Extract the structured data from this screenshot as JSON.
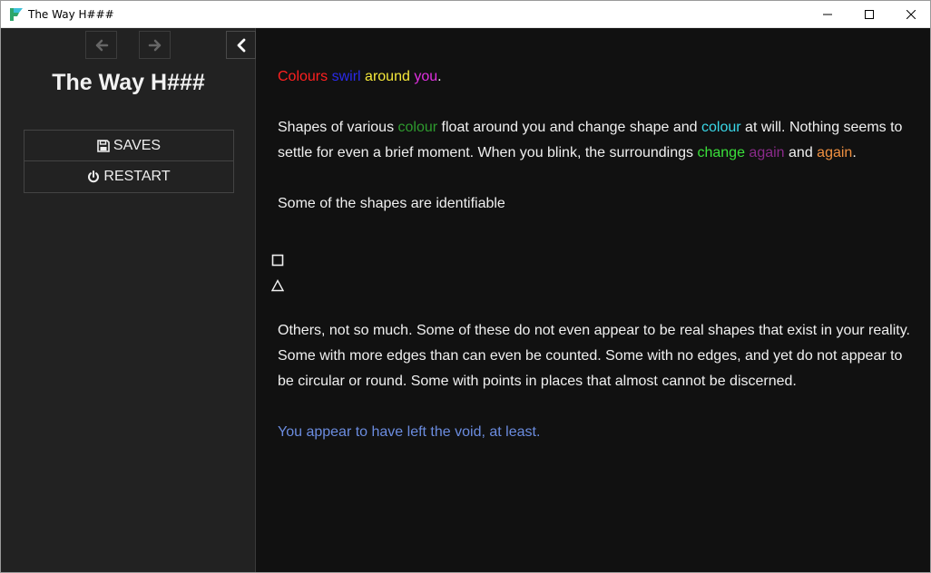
{
  "window": {
    "title": "The Way H###"
  },
  "sidebar": {
    "story_title": "The Way H###",
    "menu": {
      "saves_label": "SAVES",
      "restart_label": "RESTART"
    }
  },
  "passage": {
    "p1": [
      {
        "text": "Colours",
        "color": "#ff2020"
      },
      {
        "text": " ",
        "color": "#ffffff"
      },
      {
        "text": "swirl",
        "color": "#2a2ae8"
      },
      {
        "text": " ",
        "color": "#ffffff"
      },
      {
        "text": "around",
        "color": "#f5e83a"
      },
      {
        "text": " ",
        "color": "#ffffff"
      },
      {
        "text": "you",
        "color": "#e030e0"
      },
      {
        "text": ".",
        "color": "#f0f0f0"
      }
    ],
    "p2": [
      {
        "text": "Shapes of various ",
        "color": "#f0f0f0"
      },
      {
        "text": "colour",
        "color": "#2e9a2e"
      },
      {
        "text": " float around you and change shape and ",
        "color": "#f0f0f0"
      },
      {
        "text": "colour",
        "color": "#3ad8e8"
      },
      {
        "text": " at will. Nothing seems to settle for even a brief moment. When you blink, the surroundings ",
        "color": "#f0f0f0"
      },
      {
        "text": "change",
        "color": "#3ae03a"
      },
      {
        "text": " ",
        "color": "#f0f0f0"
      },
      {
        "text": "again",
        "color": "#8a2a8a"
      },
      {
        "text": " and ",
        "color": "#f0f0f0"
      },
      {
        "text": "again",
        "color": "#f09040"
      },
      {
        "text": ".",
        "color": "#f0f0f0"
      }
    ],
    "p3": "Some of the shapes are identifiable",
    "shapes": [
      "□",
      "△"
    ],
    "p4": "Others, not so much. Some of these do not even appear to be real shapes that exist in your reality. Some with more edges than can even be counted. Some with no edges, and yet do not appear to be circular or round. Some with points in places that almost cannot be discerned.",
    "link": "You appear to have left the void, at least."
  },
  "colors": {
    "background": "#111111",
    "sidebar": "#222222",
    "link": "#6b8cdf"
  }
}
